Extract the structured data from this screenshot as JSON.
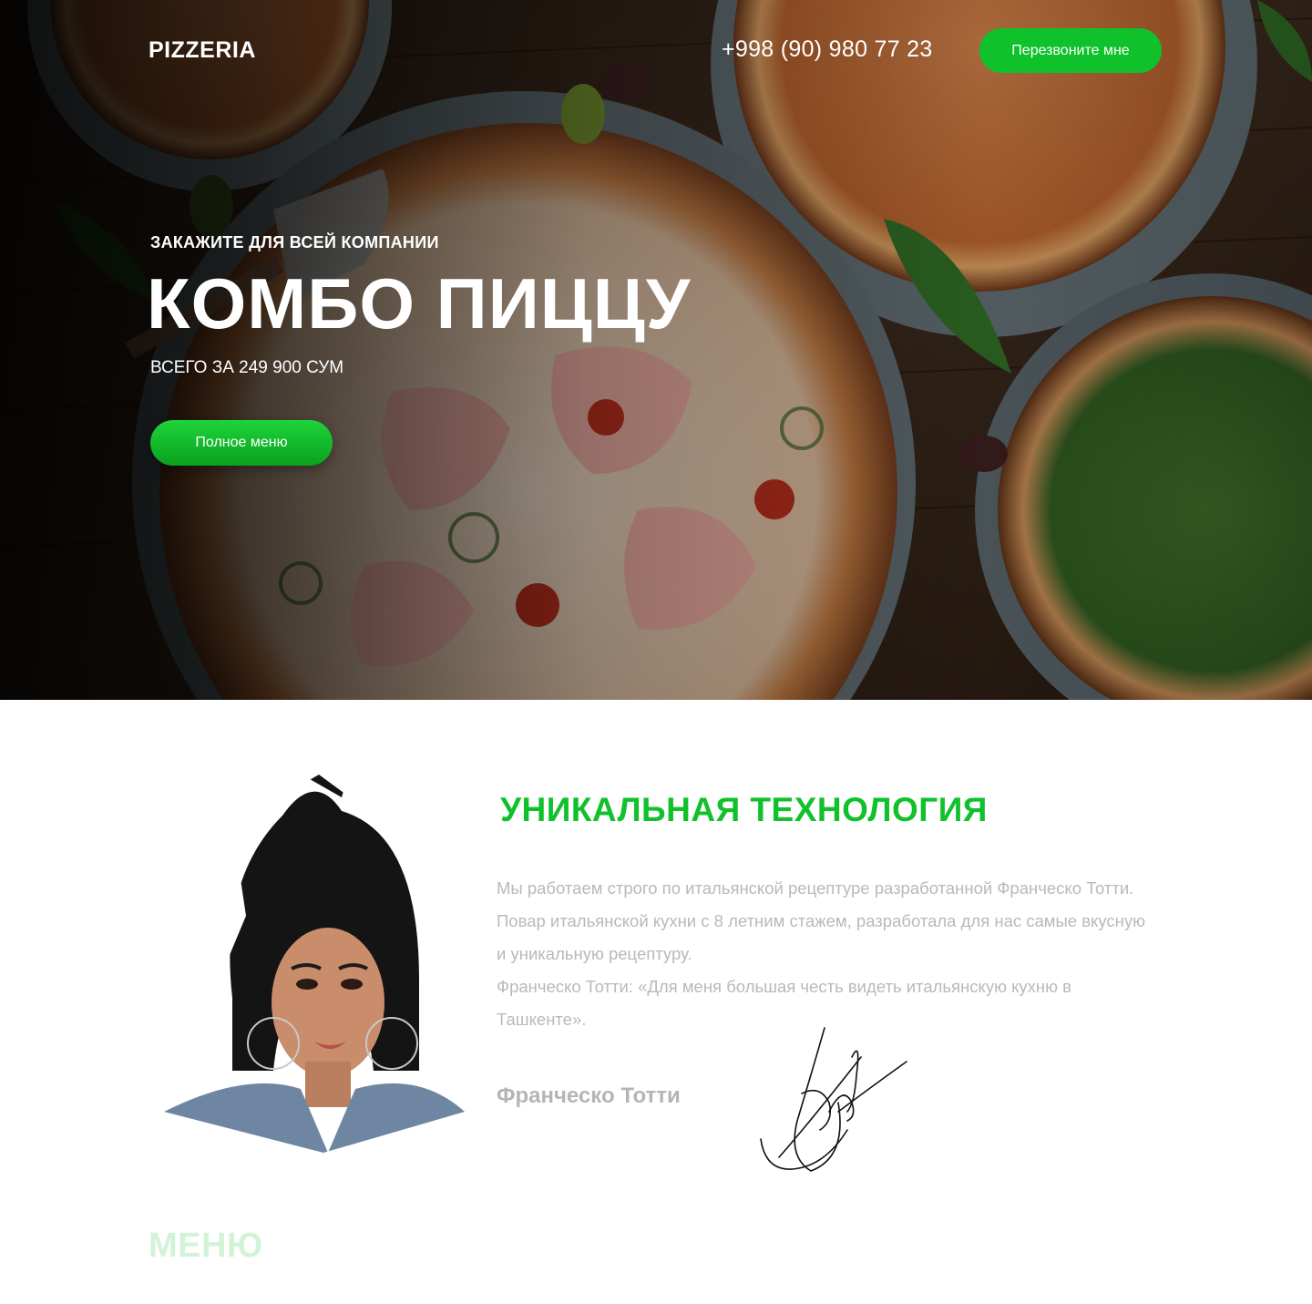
{
  "header": {
    "logo": "PIZZERIA",
    "phone": "+998 (90) 980 77 23",
    "callback_label": "Перезвоните мне"
  },
  "hero": {
    "kicker": "ЗАКАЖИТЕ ДЛЯ ВСЕЙ КОМПАНИИ",
    "headline": "КОМБО ПИЦЦУ",
    "price": "ВСЕГО ЗА 249 900 СУМ",
    "menu_button_label": "Полное меню"
  },
  "about": {
    "title": "УНИКАЛЬНАЯ ТЕХНОЛОГИЯ",
    "paragraph1": "Мы работаем строго по итальянской рецептуре разработанной Франческо Тотти. Повар итальянской кухни с 8 летним стажем, разработала для нас самые вкусную и уникальную рецептуру.",
    "paragraph2": "Франческо Тотти: «Для меня большая честь видеть итальянскую кухню в Ташкенте».",
    "signer": "Франческо Тотти"
  },
  "menu_section": {
    "heading": "МЕНЮ"
  },
  "colors": {
    "accent": "#0fc22b",
    "title_green": "#11c12b",
    "text_gray": "#b9b9b9",
    "menu_heading": "#d2f3d6"
  }
}
